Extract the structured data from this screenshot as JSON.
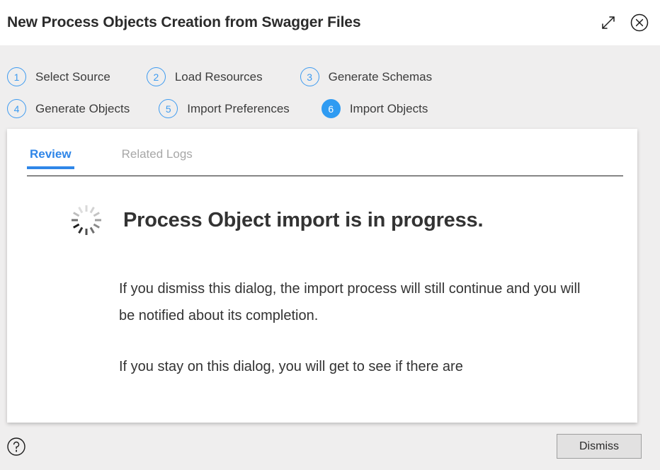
{
  "window": {
    "title": "New Process Objects Creation from Swagger Files",
    "expand_icon": "expand-diagonal-arrows-icon",
    "close_icon": "close-circle-icon",
    "accent_color": "#2f86e8",
    "step_accent_color": "#3e9bf0",
    "background_color": "#efeeee"
  },
  "steps": {
    "row1": [
      {
        "number": "1",
        "label": "Select Source",
        "active": false
      },
      {
        "number": "2",
        "label": "Load Resources",
        "active": false
      },
      {
        "number": "3",
        "label": "Generate Schemas",
        "active": false
      }
    ],
    "row2": [
      {
        "number": "4",
        "label": "Generate Objects",
        "active": false
      },
      {
        "number": "5",
        "label": "Import Preferences",
        "active": false
      },
      {
        "number": "6",
        "label": "Import Objects",
        "active": true
      }
    ]
  },
  "tabs": [
    {
      "label": "Review",
      "active": true
    },
    {
      "label": "Related Logs",
      "active": false
    }
  ],
  "content": {
    "spinner_icon": "loading-spinner-icon",
    "heading": "Process Object import is in progress.",
    "paragraph1": "If you dismiss this dialog, the import process will still continue and you will be notified about its completion.",
    "paragraph2": "If you stay on this dialog, you will get to see if there are"
  },
  "footer": {
    "help_icon": "help-circle-icon",
    "dismiss_label": "Dismiss"
  }
}
